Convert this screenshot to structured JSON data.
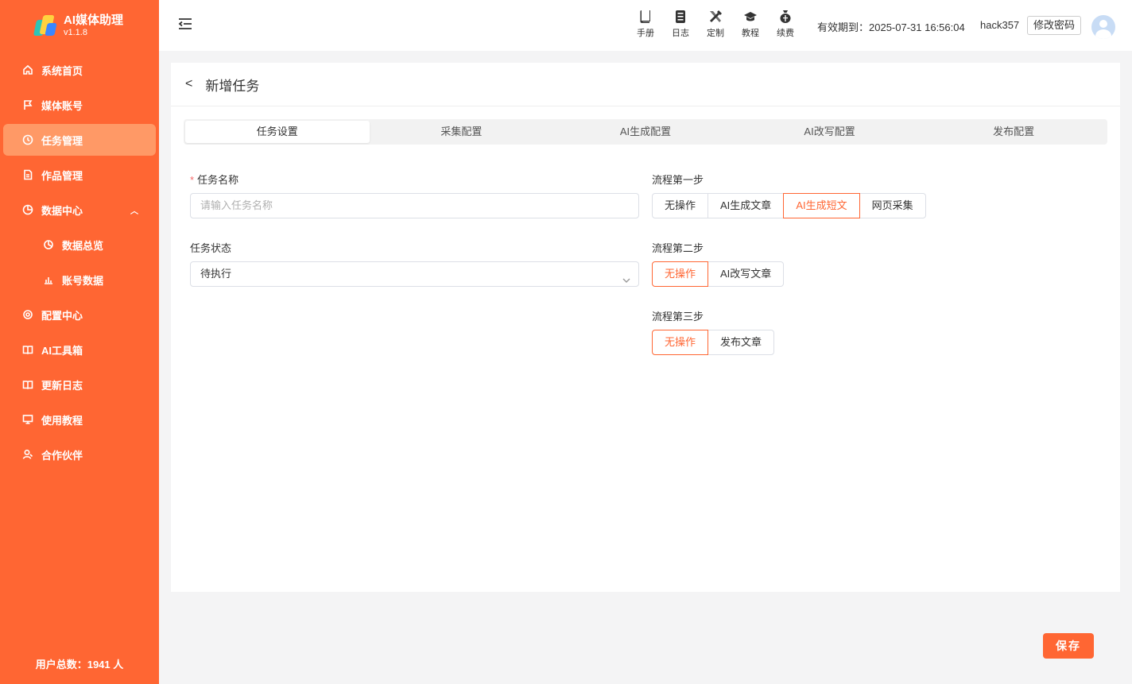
{
  "brand": {
    "name": "AI媒体助理",
    "version": "v1.1.8"
  },
  "sidebar": {
    "items": [
      {
        "label": "系统首页",
        "icon": "home-icon"
      },
      {
        "label": "媒体账号",
        "icon": "flag-icon"
      },
      {
        "label": "任务管理",
        "icon": "clock-icon",
        "active": true
      },
      {
        "label": "作品管理",
        "icon": "document-icon"
      },
      {
        "label": "数据中心",
        "icon": "chart-pie-icon",
        "expanded": true
      },
      {
        "label": "数据总览",
        "icon": "pie-icon",
        "sub": true
      },
      {
        "label": "账号数据",
        "icon": "bar-chart-icon",
        "sub": true
      },
      {
        "label": "配置中心",
        "icon": "gear-icon"
      },
      {
        "label": "AI工具箱",
        "icon": "book-icon"
      },
      {
        "label": "更新日志",
        "icon": "book-icon"
      },
      {
        "label": "使用教程",
        "icon": "monitor-icon"
      },
      {
        "label": "合作伙伴",
        "icon": "user-icon"
      }
    ],
    "footer": "用户总数：1941 人"
  },
  "header": {
    "tools": [
      {
        "label": "手册",
        "icon": "manual-icon"
      },
      {
        "label": "日志",
        "icon": "log-icon"
      },
      {
        "label": "定制",
        "icon": "custom-icon"
      },
      {
        "label": "教程",
        "icon": "graduation-cap-icon"
      },
      {
        "label": "续费",
        "icon": "money-bag-icon"
      }
    ],
    "expiry": "有效期到：2025-07-31 16:56:04",
    "username": "hack357",
    "change_password": "修改密码"
  },
  "page": {
    "title": "新增任务",
    "tabs": [
      "任务设置",
      "采集配置",
      "AI生成配置",
      "AI改写配置",
      "发布配置"
    ],
    "active_tab": 0
  },
  "form": {
    "task_name": {
      "label": "任务名称",
      "required": "*",
      "placeholder": "请输入任务名称",
      "value": ""
    },
    "task_status": {
      "label": "任务状态",
      "value": "待执行"
    },
    "step1": {
      "label": "流程第一步",
      "options": [
        "无操作",
        "AI生成文章",
        "AI生成短文",
        "网页采集"
      ],
      "selected": 2
    },
    "step2": {
      "label": "流程第二步",
      "options": [
        "无操作",
        "AI改写文章"
      ],
      "selected": 0
    },
    "step3": {
      "label": "流程第三步",
      "options": [
        "无操作",
        "发布文章"
      ],
      "selected": 0
    }
  },
  "save_label": "保存",
  "colors": {
    "primary": "#ff6633",
    "active_menu": "#ff9966"
  }
}
